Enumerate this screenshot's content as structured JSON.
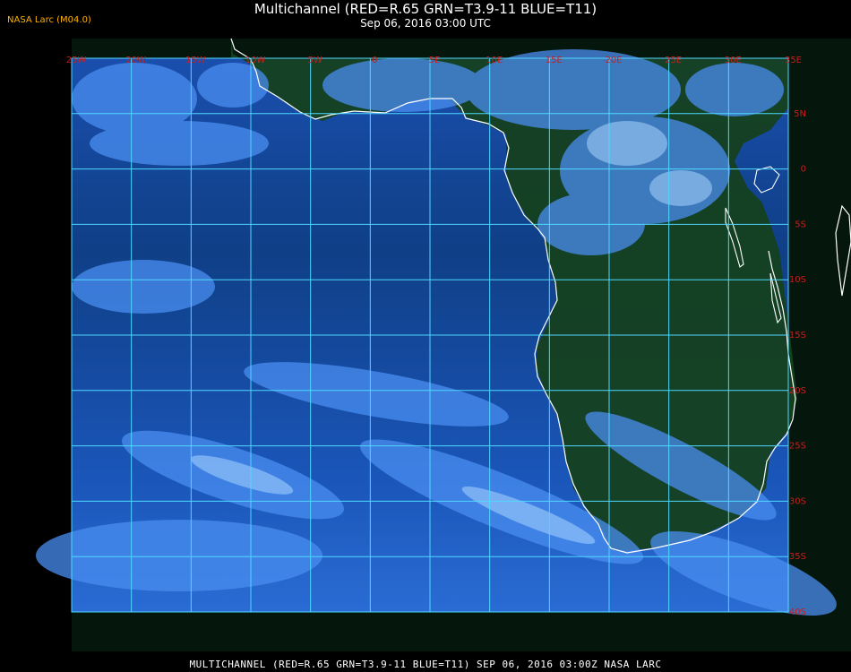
{
  "header": {
    "badge": "NASA Larc (M04.0)",
    "title": "Multichannel (RED=R.65 GRN=T3.9-11 BLUE=T11)",
    "datetime": "Sep 06, 2016 03:00 UTC"
  },
  "footer": {
    "caption": "MULTICHANNEL (RED=R.65 GRN=T3.9-11 BLUE=T11) SEP 06, 2016 03:00Z   NASA LARC"
  },
  "map": {
    "grid_color": "#4fd8ff",
    "label_color": "#c81e1e",
    "coast_color": "#ffffff",
    "ocean_color": "#0f3a8a",
    "land_color": "#123f22",
    "lon_labels": [
      "25W",
      "20W",
      "15W",
      "10W",
      "5W",
      "0",
      "5E",
      "10E",
      "15E",
      "20E",
      "25E",
      "30E",
      "35E"
    ],
    "lat_labels": [
      "5N",
      "0",
      "5S",
      "10S",
      "15S",
      "20S",
      "25S",
      "30S",
      "35S",
      "40S"
    ]
  }
}
